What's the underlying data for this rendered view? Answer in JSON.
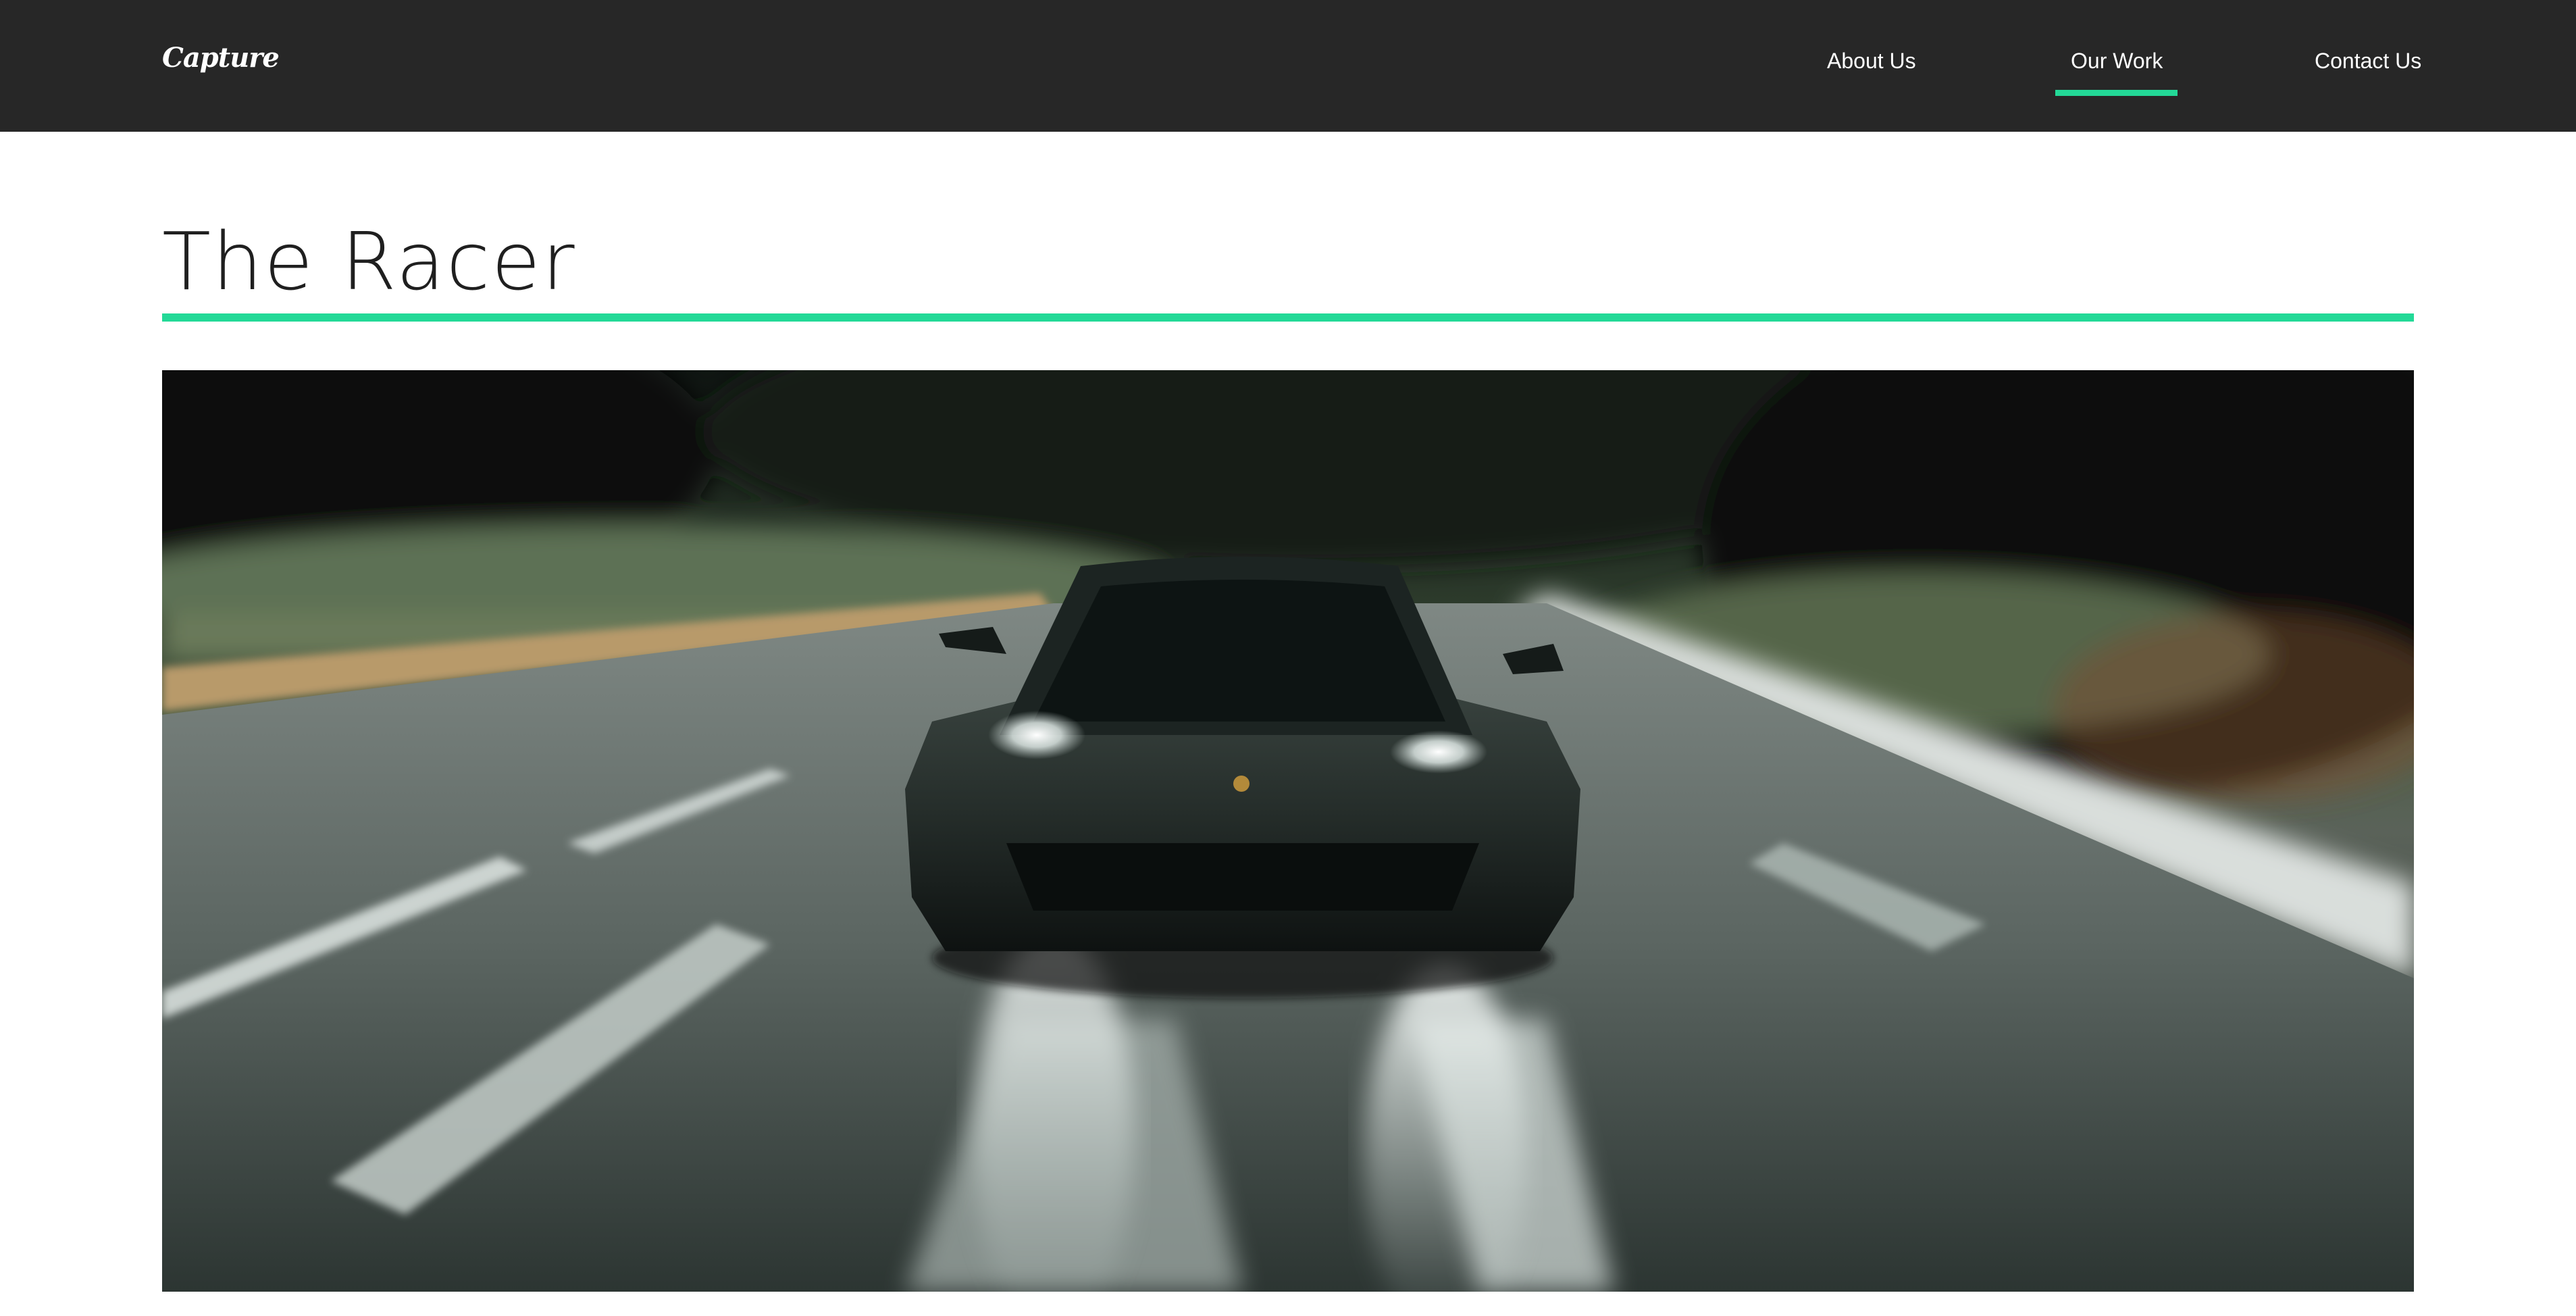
{
  "brand": {
    "logo": "Capture"
  },
  "nav": {
    "links": [
      {
        "label": "About Us",
        "active": false
      },
      {
        "label": "Our Work",
        "active": true
      },
      {
        "label": "Contact Us",
        "active": false
      }
    ]
  },
  "page": {
    "title": "The Racer"
  },
  "colors": {
    "nav_bg": "#272727",
    "accent": "#23d997",
    "text_dark": "#1f1f1f"
  },
  "hero": {
    "icon": "car-photo"
  }
}
